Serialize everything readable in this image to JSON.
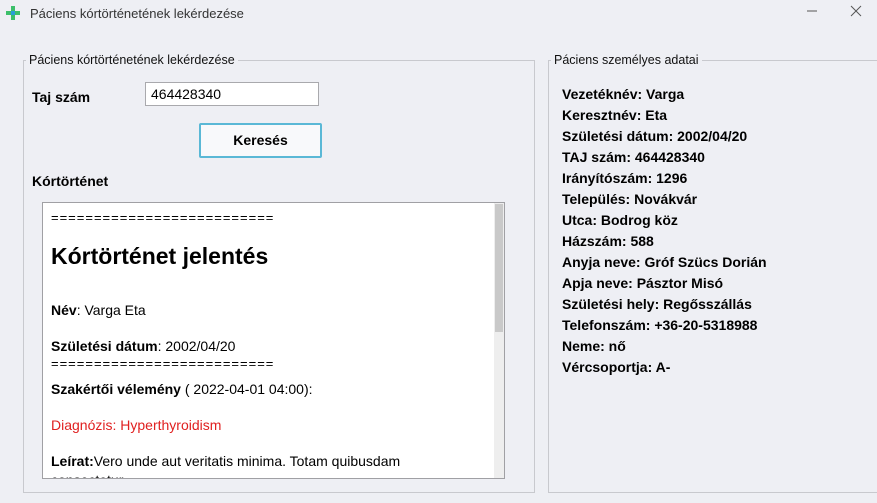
{
  "window": {
    "title": "Páciens kórtörténetének lekérdezése",
    "icon": "medical-cross-icon",
    "accent": "#3cbf6a"
  },
  "left_panel": {
    "legend": "Páciens kórtörténetének lekérdezése",
    "taj_label": "Taj szám",
    "taj_value": "464428340",
    "search_label": "Keresés",
    "history_label": "Kórtörténet"
  },
  "report": {
    "separator": "==========================",
    "title": "Kórtörténet jelentés",
    "name_label": "Név",
    "name_value": ": Varga Eta",
    "dob_label": "Születési dátum",
    "dob_value": ": 2002/04/20",
    "opinion_label": "Szakértői vélemény",
    "opinion_date": " ( 2022-04-01 04:00):",
    "diagnosis": "Diagnózis: Hyperthyroidism",
    "desc_label": "Leírat:",
    "desc_value": "Vero unde aut veritatis minima. Totam quibusdam",
    "desc_cont": "consectetur"
  },
  "right_panel": {
    "legend": "Páciens személyes adatai",
    "lines": [
      "Vezetéknév: Varga",
      "Keresztnév: Eta",
      "Születési dátum: 2002/04/20",
      "TAJ szám: 464428340",
      "Irányítószám: 1296",
      "Település: Novákvár",
      "Utca: Bodrog köz",
      "Házszám: 588",
      "Anyja neve: Gróf Szücs Dorián",
      "Apja neve: Pásztor Misó",
      "Születési hely: Regősszállás",
      "Telefonszám: +36-20-5318988",
      "Neme: nő",
      "Vércsoportja: A-"
    ]
  }
}
